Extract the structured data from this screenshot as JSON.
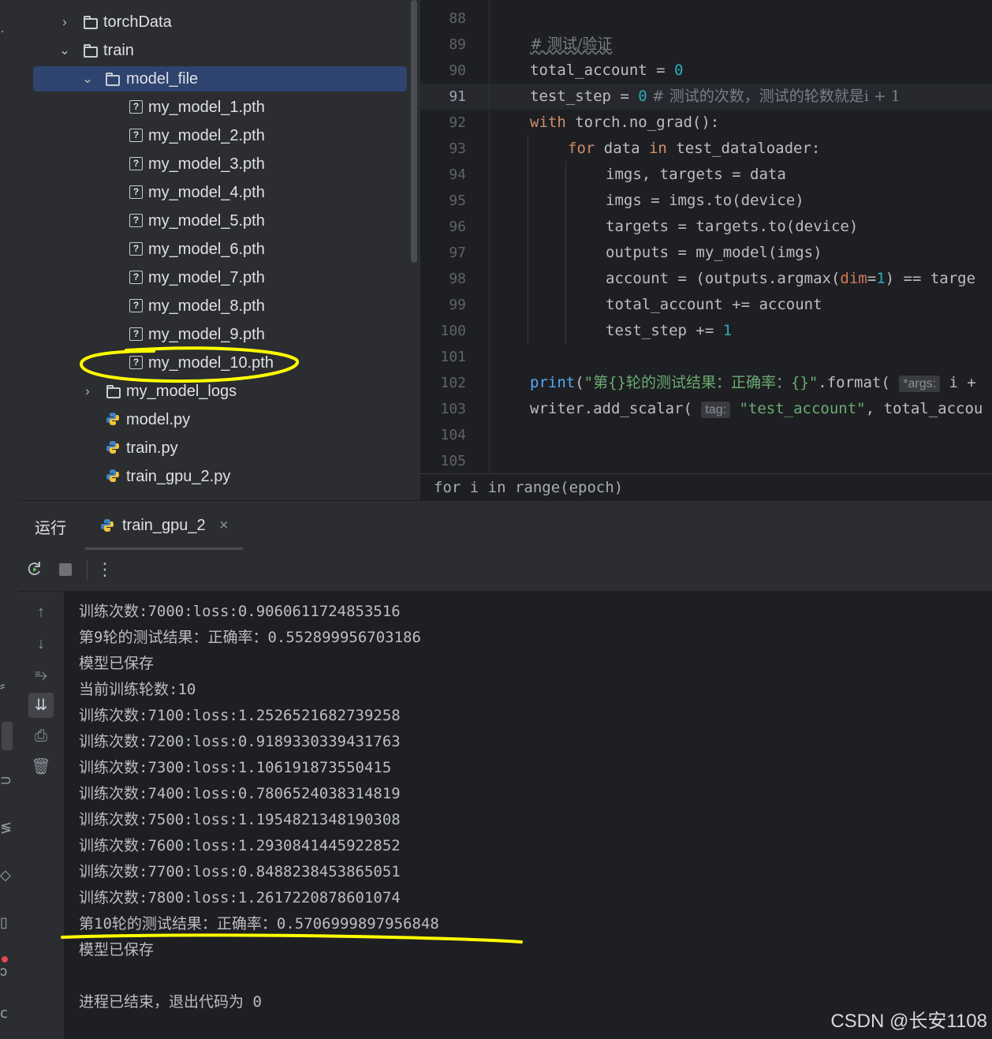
{
  "tree": {
    "items": [
      {
        "label": "torchData",
        "kind": "folder",
        "expanded": false
      },
      {
        "label": "train",
        "kind": "folder",
        "expanded": true
      },
      {
        "label": "model_file",
        "kind": "folder",
        "expanded": true,
        "selected": true
      },
      {
        "label": "my_model_1.pth",
        "kind": "unknown-file"
      },
      {
        "label": "my_model_2.pth",
        "kind": "unknown-file"
      },
      {
        "label": "my_model_3.pth",
        "kind": "unknown-file"
      },
      {
        "label": "my_model_4.pth",
        "kind": "unknown-file"
      },
      {
        "label": "my_model_5.pth",
        "kind": "unknown-file"
      },
      {
        "label": "my_model_6.pth",
        "kind": "unknown-file"
      },
      {
        "label": "my_model_7.pth",
        "kind": "unknown-file"
      },
      {
        "label": "my_model_8.pth",
        "kind": "unknown-file"
      },
      {
        "label": "my_model_9.pth",
        "kind": "unknown-file"
      },
      {
        "label": "my_model_10.pth",
        "kind": "unknown-file",
        "highlighted": true
      },
      {
        "label": "my_model_logs",
        "kind": "folder",
        "expanded": false
      },
      {
        "label": "model.py",
        "kind": "python-file"
      },
      {
        "label": "train.py",
        "kind": "python-file"
      },
      {
        "label": "train_gpu_2.py",
        "kind": "python-file"
      }
    ]
  },
  "editor": {
    "line_numbers": [
      "88",
      "89",
      "90",
      "91",
      "92",
      "93",
      "94",
      "95",
      "96",
      "97",
      "98",
      "99",
      "100",
      "101",
      "102",
      "103",
      "104",
      "105"
    ],
    "current_line": "91",
    "code": {
      "l89_comment": "# 测试/验证",
      "l90_a": "total_account = ",
      "l90_num": "0",
      "l91_a": "test_step = ",
      "l91_num": "0",
      "l91_comment": " # 测试的次数，测试的轮数就是i + 1",
      "l92_kw": "with",
      "l92_rest": " torch.no_grad():",
      "l93_kw": "for",
      "l93_a": " data ",
      "l93_kw2": "in",
      "l93_b": " test_dataloader:",
      "l94": "imgs, targets = data",
      "l95": "imgs = imgs.to(device)",
      "l96": "targets = targets.to(device)",
      "l97": "outputs = my_model(imgs)",
      "l98_a": "account = (outputs.argmax(",
      "l98_param": "dim",
      "l98_eq": "=",
      "l98_num": "1",
      "l98_b": ") == targe",
      "l99": "total_account += account",
      "l100_a": "test_step += ",
      "l100_num": "1",
      "l102_fn": "print",
      "l102_open": "(",
      "l102_str": "\"第{}轮的测试结果：正确率：{}\"",
      "l102_b": ".format( ",
      "l102_hint": "*args:",
      "l102_c": " i + ",
      "l103_a": "writer.add_scalar( ",
      "l103_hint": "tag:",
      "l103_str": " \"test_account\"",
      "l103_b": ", total_accou"
    },
    "breadcrumb": "for i in range(epoch)"
  },
  "run": {
    "title": "运行",
    "tab_label": "train_gpu_2",
    "tab_close": "×"
  },
  "console": {
    "lines": [
      "训练次数:7000:loss:0.9060611724853516",
      "第9轮的测试结果：正确率：0.552899956703186",
      "模型已保存",
      "当前训练轮数:10",
      "训练次数:7100:loss:1.2526521682739258",
      "训练次数:7200:loss:0.9189330339431763",
      "训练次数:7300:loss:1.106191873550415",
      "训练次数:7400:loss:0.7806524038314819",
      "训练次数:7500:loss:1.1954821348190308",
      "训练次数:7600:loss:1.2930841445922852",
      "训练次数:7700:loss:0.8488238453865051",
      "训练次数:7800:loss:1.2617220878601074",
      "第10轮的测试结果：正确率：0.5706999897956848",
      "模型已保存",
      "",
      "进程已结束，退出代码为 0"
    ]
  },
  "watermark": "CSDN @长安1108",
  "colors": {
    "annotation": "#ffff00",
    "selection": "#2e436e",
    "keyword": "#cf8e6d",
    "number": "#2aacb8",
    "string": "#6aab73"
  }
}
